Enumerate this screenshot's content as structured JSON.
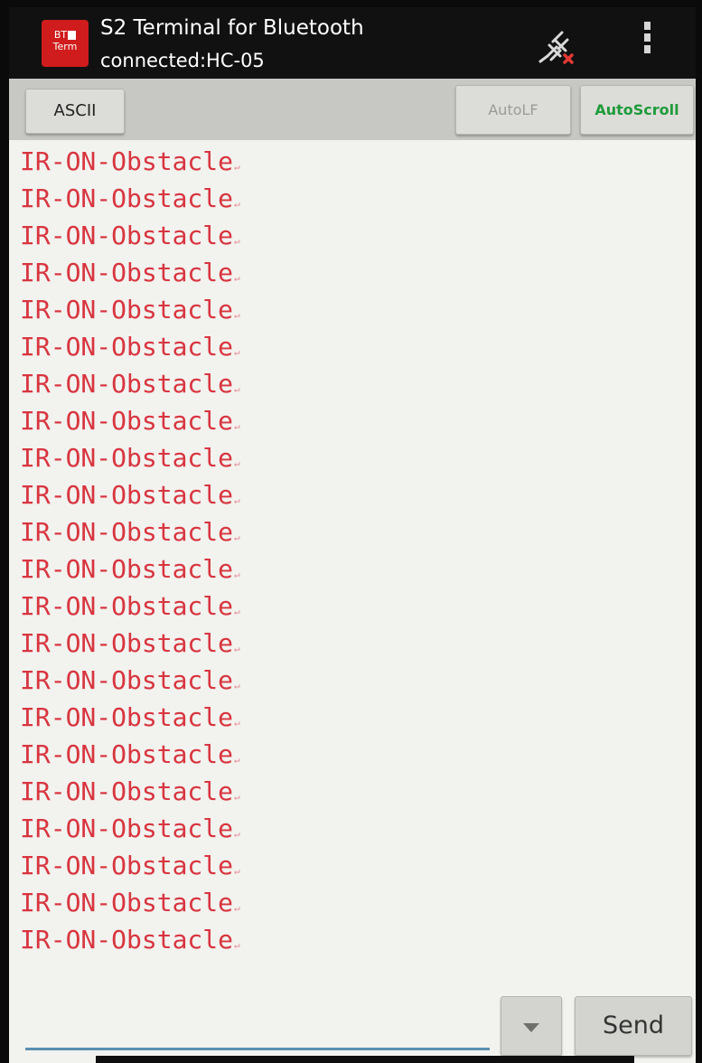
{
  "header": {
    "app_icon_label_top": "BT",
    "app_icon_label_bottom": "Term",
    "title": "S2 Terminal for Bluetooth",
    "subtitle": "connected:HC-05",
    "disconnect_icon": "bluetooth-disconnect-icon",
    "overflow_icon": "overflow-menu-icon"
  },
  "toolbar": {
    "ascii_label": "ASCII",
    "autolf_label": "AutoLF",
    "autoscroll_label": "AutoScroll"
  },
  "terminal": {
    "lines": [
      "IR-ON-Obstacle",
      "IR-ON-Obstacle",
      "IR-ON-Obstacle",
      "IR-ON-Obstacle",
      "IR-ON-Obstacle",
      "IR-ON-Obstacle",
      "IR-ON-Obstacle",
      "IR-ON-Obstacle",
      "IR-ON-Obstacle",
      "IR-ON-Obstacle",
      "IR-ON-Obstacle",
      "IR-ON-Obstacle",
      "IR-ON-Obstacle",
      "IR-ON-Obstacle",
      "IR-ON-Obstacle",
      "IR-ON-Obstacle",
      "IR-ON-Obstacle",
      "IR-ON-Obstacle",
      "IR-ON-Obstacle",
      "IR-ON-Obstacle",
      "IR-ON-Obstacle",
      "IR-ON-Obstacle"
    ],
    "eol_marker": "↵"
  },
  "input": {
    "value": "",
    "dropdown_icon": "dropdown-arrow-icon",
    "send_label": "Send"
  },
  "colors": {
    "text_red": "#d8353f",
    "autoscroll_green": "#1f9b3a",
    "app_icon_red": "#d01c1c"
  }
}
